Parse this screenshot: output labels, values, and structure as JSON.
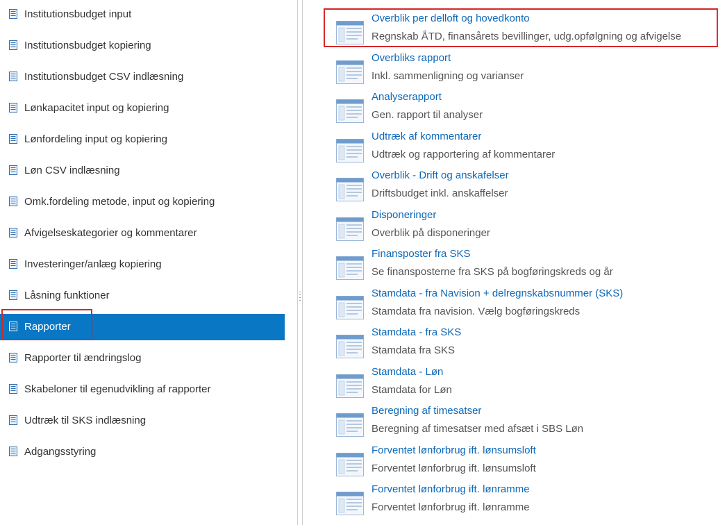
{
  "colors": {
    "active_bg": "#0a77c5",
    "link": "#0d68b8",
    "highlight": "#d62727"
  },
  "sidebar": {
    "items": [
      {
        "label": "Institutionsbudget input"
      },
      {
        "label": "Institutionsbudget kopiering"
      },
      {
        "label": "Institutionsbudget CSV indlæsning"
      },
      {
        "label": "Lønkapacitet input og kopiering"
      },
      {
        "label": "Lønfordeling input og kopiering"
      },
      {
        "label": "Løn CSV indlæsning"
      },
      {
        "label": "Omk.fordeling metode, input og kopiering"
      },
      {
        "label": "Afvigelseskategorier og kommentarer"
      },
      {
        "label": "Investeringer/anlæg kopiering"
      },
      {
        "label": "Låsning funktioner"
      },
      {
        "label": "Rapporter",
        "selected": true
      },
      {
        "label": "Rapporter til ændringslog"
      },
      {
        "label": "Skabeloner til egenudvikling af rapporter"
      },
      {
        "label": "Udtræk til SKS indlæsning"
      },
      {
        "label": "Adgangsstyring"
      }
    ]
  },
  "reports": [
    {
      "title": "Overblik per delloft og hovedkonto",
      "desc": "Regnskab ÅTD, finansårets bevillinger, udg.opfølgning og afvigelse"
    },
    {
      "title": "Overbliks rapport",
      "desc": "Inkl. sammenligning og varianser"
    },
    {
      "title": "Analyserapport",
      "desc": "Gen. rapport til analyser"
    },
    {
      "title": "Udtræk af kommentarer",
      "desc": "Udtræk og rapportering af kommentarer"
    },
    {
      "title": "Overblik - Drift og anskafelser",
      "desc": "Driftsbudget inkl. anskaffelser"
    },
    {
      "title": "Disponeringer",
      "desc": "Overblik på disponeringer"
    },
    {
      "title": "Finansposter fra SKS",
      "desc": "Se finansposterne fra SKS på bogføringskreds og år"
    },
    {
      "title": "Stamdata - fra Navision + delregnskabsnummer (SKS)",
      "desc": "Stamdata fra navision. Vælg bogføringskreds"
    },
    {
      "title": "Stamdata - fra SKS",
      "desc": "Stamdata fra SKS"
    },
    {
      "title": "Stamdata - Løn",
      "desc": "Stamdata for Løn"
    },
    {
      "title": "Beregning af timesatser",
      "desc": "Beregning af timesatser med afsæt i SBS Løn"
    },
    {
      "title": "Forventet lønforbrug ift. lønsumsloft",
      "desc": "Forventet lønforbrug ift. lønsumsloft"
    },
    {
      "title": "Forventet lønforbrug ift. lønramme",
      "desc": "Forventet lønforbrug ift. lønramme"
    }
  ]
}
